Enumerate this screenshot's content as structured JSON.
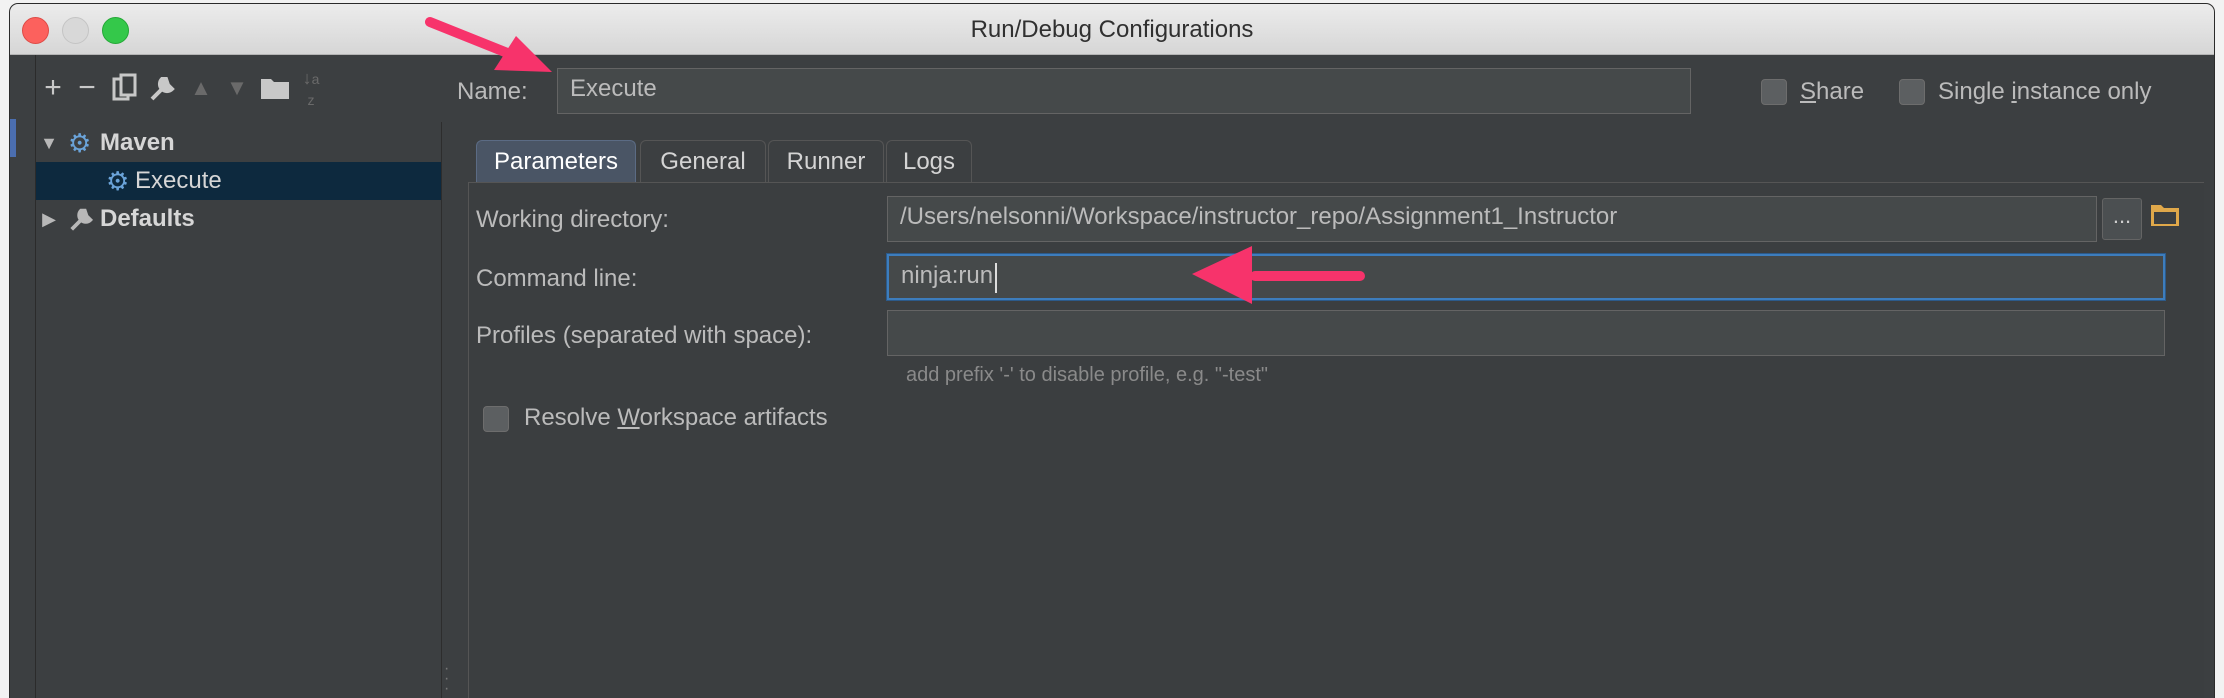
{
  "window": {
    "title": "Run/Debug Configurations"
  },
  "toolbar": {
    "icons": [
      "plus-icon",
      "minus-icon",
      "copy-icon",
      "wrench-icon",
      "arrow-up-icon",
      "arrow-down-icon",
      "folder-icon",
      "sort-az-icon"
    ]
  },
  "tree": {
    "items": [
      {
        "label": "Maven",
        "expanded": true,
        "bold": true,
        "icon": "gear-icon"
      },
      {
        "label": "Execute",
        "selected": true,
        "icon": "gear-icon"
      },
      {
        "label": "Defaults",
        "expanded": false,
        "bold": true,
        "icon": "wrench-icon"
      }
    ]
  },
  "header": {
    "name_label": "Name:",
    "name_value": "Execute",
    "share_label": "Share",
    "share_checked": false,
    "single_instance_label": "Single instance only",
    "single_instance_checked": false
  },
  "tabs": [
    {
      "label": "Parameters",
      "active": true
    },
    {
      "label": "General",
      "active": false
    },
    {
      "label": "Runner",
      "active": false
    },
    {
      "label": "Logs",
      "active": false
    }
  ],
  "form": {
    "working_directory_label": "Working directory:",
    "working_directory_value": "/Users/nelsonni/Workspace/instructor_repo/Assignment1_Instructor",
    "browse_label": "...",
    "command_line_label": "Command line:",
    "command_line_value": "ninja:run",
    "profiles_label": "Profiles (separated with space):",
    "profiles_value": "",
    "profiles_hint": "add prefix '-' to disable profile, e.g. \"-test\"",
    "resolve_workspace_label": "Resolve Workspace artifacts",
    "resolve_workspace_checked": false
  },
  "colors": {
    "background": "#3c3f41",
    "selection": "#0d293e",
    "accent": "#3d7dbd",
    "annotation_arrow": "#f7336b"
  }
}
